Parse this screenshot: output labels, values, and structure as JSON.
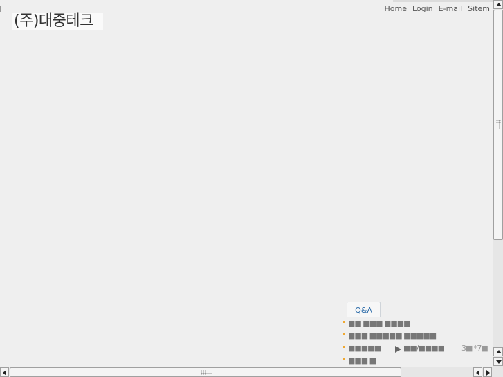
{
  "header": {
    "logo_text": "(주)대중테크",
    "nav": [
      "Home",
      "Login",
      "E-mail",
      "Sitem"
    ]
  },
  "qa": {
    "tab_label": "Q&A",
    "items": [
      {
        "text": "■■ ■■■ ■■■■"
      },
      {
        "text": "■■■ ■■■■■ ■■■■■"
      },
      {
        "text": "■■■■■",
        "after_arrow": "■■/■■■■",
        "meta": "3■  *7■"
      },
      {
        "text": "■■■ ■"
      }
    ]
  },
  "colors": {
    "bullet": "#f0a830",
    "tab_text": "#2a6aa8",
    "background": "#efefef"
  }
}
